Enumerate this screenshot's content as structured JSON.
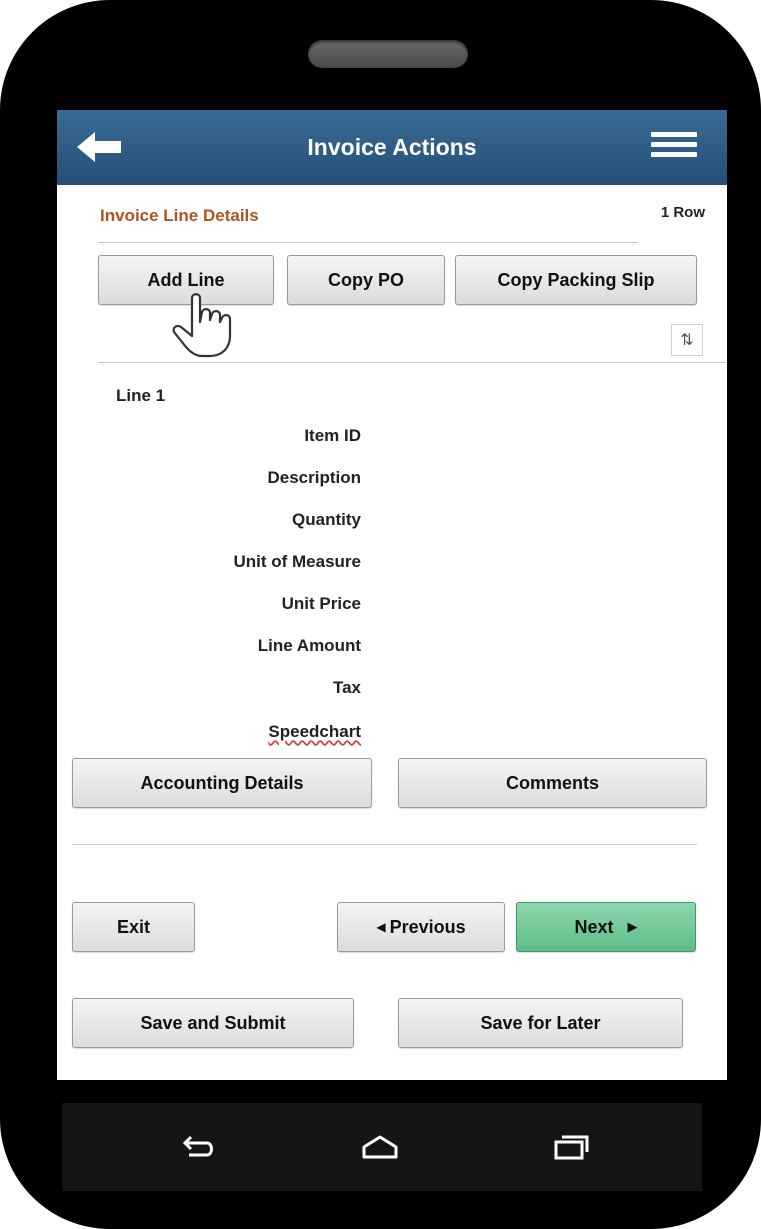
{
  "header": {
    "title": "Invoice Actions",
    "back_icon": "back-arrow-icon",
    "menu_icon": "hamburger-menu-icon"
  },
  "section": {
    "title": "Invoice Line Details",
    "row_count": "1 Row"
  },
  "toolbar": {
    "add_line": "Add Line",
    "copy_po": "Copy PO",
    "copy_packing_slip": "Copy Packing Slip",
    "sort_icon": "sort-icon"
  },
  "line": {
    "label": "Line  1",
    "fields": [
      "Item ID",
      "Description",
      "Quantity",
      "Unit of Measure",
      "Unit Price",
      "Line Amount",
      "Tax",
      "Speedchart"
    ]
  },
  "detail_buttons": {
    "accounting": "Accounting Details",
    "comments": "Comments"
  },
  "nav": {
    "exit": "Exit",
    "previous": "Previous",
    "next": "Next"
  },
  "actions": {
    "save_submit": "Save and Submit",
    "save_later": "Save for Later"
  },
  "colors": {
    "header": "#2f5d86",
    "section_title": "#b0551e",
    "next_button": "#6cc593"
  }
}
